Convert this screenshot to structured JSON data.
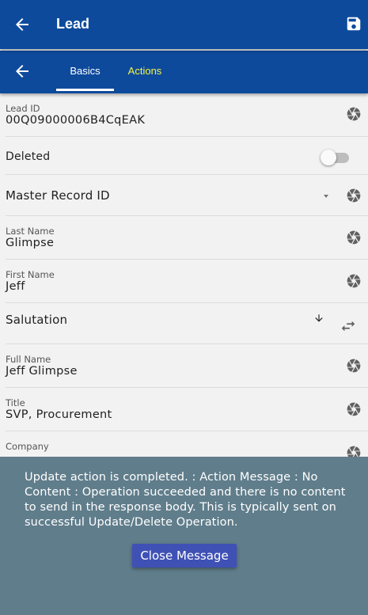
{
  "appbar": {
    "title": "Lead",
    "back_icon": "arrow-left-icon",
    "save_icon": "save-icon"
  },
  "tabs": {
    "back_icon": "arrow-left-icon",
    "items": [
      {
        "label": "Basics",
        "active": true
      },
      {
        "label": "Actions",
        "active": false
      }
    ]
  },
  "fields": {
    "lead_id": {
      "label": "Lead ID",
      "value": "00Q09000006B4CqEAK"
    },
    "deleted": {
      "label": "Deleted",
      "checked": false
    },
    "master_record_id": {
      "label": "Master Record ID"
    },
    "last_name": {
      "label": "Last Name",
      "value": "Glimpse"
    },
    "first_name": {
      "label": "First Name",
      "value": "Jeff"
    },
    "salutation": {
      "label": "Salutation"
    },
    "full_name": {
      "label": "Full Name",
      "value": "Jeff Glimpse"
    },
    "title": {
      "label": "Title",
      "value": "SVP, Procurement"
    },
    "company": {
      "label": "Company",
      "value": ""
    }
  },
  "message": {
    "text": "Update action is completed.  : Action Message : No Content : Operation succeeded and there is no content to send in the response body. This is typically sent on successful Update/Delete Operation.",
    "close_label": "Close Message"
  },
  "colors": {
    "appbar": "#0d4a9c",
    "active_tab": "#ffffff",
    "inactive_tab": "#f5f542",
    "overlay": "#607d8b",
    "close_button": "#3f51b5"
  }
}
